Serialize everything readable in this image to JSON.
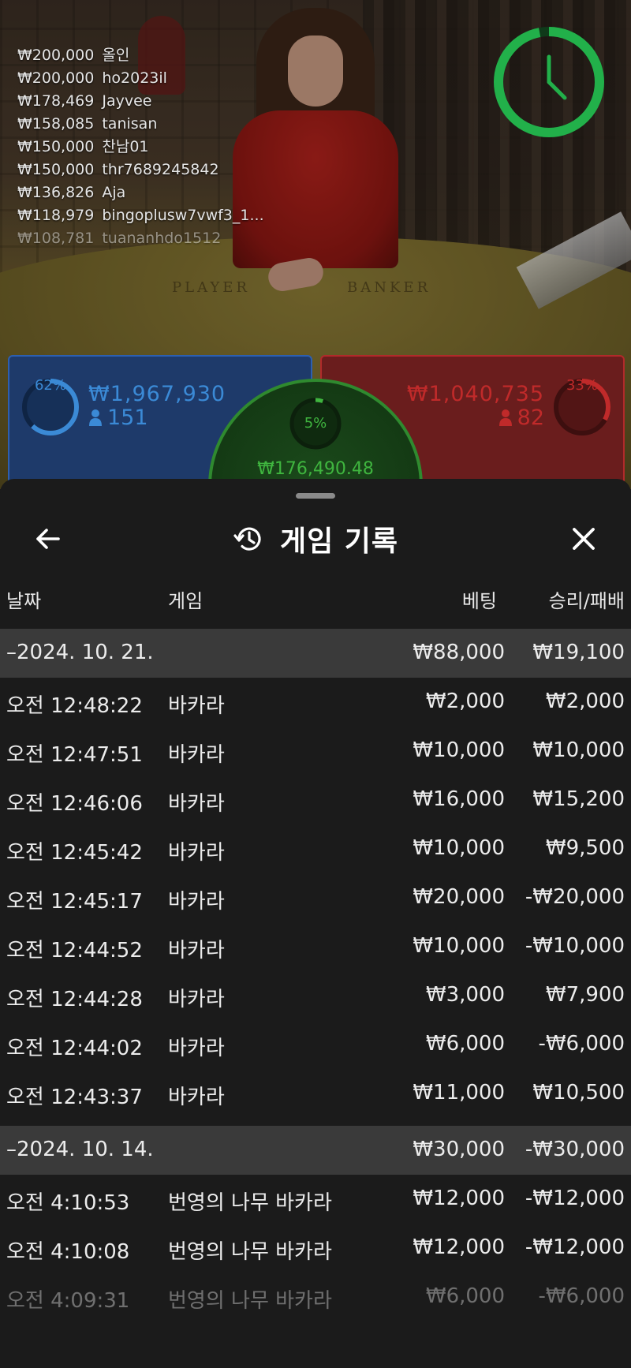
{
  "leaderboard": [
    {
      "amount": "₩200,000",
      "name": "올인"
    },
    {
      "amount": "₩200,000",
      "name": "ho2023il"
    },
    {
      "amount": "₩178,469",
      "name": "Jayvee"
    },
    {
      "amount": "₩158,085",
      "name": "tanisan"
    },
    {
      "amount": "₩150,000",
      "name": "찬남01"
    },
    {
      "amount": "₩150,000",
      "name": "thr7689245842"
    },
    {
      "amount": "₩136,826",
      "name": "Aja"
    },
    {
      "amount": "₩118,979",
      "name": "bingoplusw7vwf3_1..."
    },
    {
      "amount": "₩108,781",
      "name": "tuananhdo1512"
    }
  ],
  "table": {
    "player_label": "PLAYER",
    "banker_label": "BANKER"
  },
  "timer": {
    "remaining_fraction": 0.97,
    "color": "#22b04a",
    "icon": "clock-icon"
  },
  "bets": {
    "player": {
      "percent": "62%",
      "percent_value": 0.62,
      "amount": "₩1,967,930",
      "players": "151",
      "color": "#3b8ad6"
    },
    "banker": {
      "percent": "33%",
      "percent_value": 0.33,
      "amount": "₩1,040,735",
      "players": "82",
      "color": "#c02a2a"
    },
    "tie": {
      "percent": "5%",
      "percent_value": 0.05,
      "amount": "₩176,490.48",
      "color": "#3fb53f"
    }
  },
  "sheet": {
    "title": "게임 기록",
    "back_icon": "arrow-left-icon",
    "history_icon": "history-icon",
    "close_icon": "close-icon",
    "columns": {
      "date": "날짜",
      "game": "게임",
      "bet": "베팅",
      "result": "승리/패배"
    },
    "rows": [
      {
        "type": "date",
        "date": "–2024. 10. 21.",
        "bet": "₩88,000",
        "result": "₩19,100"
      },
      {
        "type": "item",
        "time": "오전 12:48:22",
        "game": "바카라",
        "bet": "₩2,000",
        "result": "₩2,000"
      },
      {
        "type": "item",
        "time": "오전 12:47:51",
        "game": "바카라",
        "bet": "₩10,000",
        "result": "₩10,000"
      },
      {
        "type": "item",
        "time": "오전 12:46:06",
        "game": "바카라",
        "bet": "₩16,000",
        "result": "₩15,200"
      },
      {
        "type": "item",
        "time": "오전 12:45:42",
        "game": "바카라",
        "bet": "₩10,000",
        "result": "₩9,500"
      },
      {
        "type": "item",
        "time": "오전 12:45:17",
        "game": "바카라",
        "bet": "₩20,000",
        "result": "-₩20,000"
      },
      {
        "type": "item",
        "time": "오전 12:44:52",
        "game": "바카라",
        "bet": "₩10,000",
        "result": "-₩10,000"
      },
      {
        "type": "item",
        "time": "오전 12:44:28",
        "game": "바카라",
        "bet": "₩3,000",
        "result": "₩7,900"
      },
      {
        "type": "item",
        "time": "오전 12:44:02",
        "game": "바카라",
        "bet": "₩6,000",
        "result": "-₩6,000"
      },
      {
        "type": "item",
        "time": "오전 12:43:37",
        "game": "바카라",
        "bet": "₩11,000",
        "result": "₩10,500"
      },
      {
        "type": "date",
        "date": "–2024. 10. 14.",
        "bet": "₩30,000",
        "result": "-₩30,000"
      },
      {
        "type": "item",
        "time": "오전 4:10:53",
        "game": "번영의 나무 바카라",
        "bet": "₩12,000",
        "result": "-₩12,000"
      },
      {
        "type": "item",
        "time": "오전 4:10:08",
        "game": "번영의 나무 바카라",
        "bet": "₩12,000",
        "result": "-₩12,000"
      },
      {
        "type": "item",
        "time": "오전 4:09:31",
        "game": "번영의 나무 바카라",
        "bet": "₩6,000",
        "result": "-₩6,000"
      }
    ]
  }
}
